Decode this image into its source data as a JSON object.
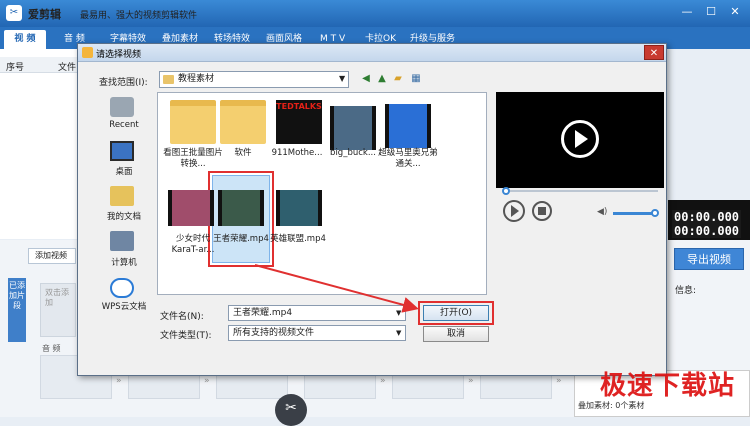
{
  "app": {
    "name": "爱剪辑",
    "slogan": "最易用、强大的视频剪辑软件",
    "tabs": [
      "视 频",
      "音 频",
      "字幕特效",
      "叠加素材",
      "转场特效",
      "画面风格",
      "M T V",
      "卡拉OK",
      "升级与服务"
    ],
    "col_headers": [
      "序号",
      "文件"
    ],
    "add_video": "添加视频",
    "side_tab": "已添加片段",
    "clip_hint": "双击添加",
    "audio_label": "音 频",
    "timecode_1": "00:00.000",
    "timecode_2": "00:00.000",
    "export": "导出视频",
    "info_label": "信息:",
    "info_row_1": "",
    "info_row_2": "叠加素材:    0个素材",
    "watermark": "极速下载站",
    "window_controls": [
      "—",
      "☐",
      "✕"
    ]
  },
  "dialog": {
    "title": "请选择视频",
    "lookin_label": "查找范围(I):",
    "lookin_value": "教程素材",
    "places": [
      "Recent",
      "桌面",
      "我的文档",
      "计算机",
      "WPS云文档"
    ],
    "files": [
      {
        "name": "看图王批量图片转换...",
        "kind": "folder"
      },
      {
        "name": "软件",
        "kind": "folder"
      },
      {
        "name": "911Mothe...",
        "kind": "video",
        "thumb_label": "TEDTALKS"
      },
      {
        "name": "big_buck...",
        "kind": "video"
      },
      {
        "name": "超级马里奥兄弟通关...",
        "kind": "video"
      },
      {
        "name": "少女时代KaraT-ar...",
        "kind": "video"
      },
      {
        "name": "王者荣耀.mp4",
        "kind": "video",
        "selected": true
      },
      {
        "name": "英雄联盟.mp4",
        "kind": "video"
      }
    ],
    "filename_label": "文件名(N):",
    "filename_value": "王者荣耀.mp4",
    "filetype_label": "文件类型(T):",
    "filetype_value": "所有支持的视频文件",
    "open_button": "打开(O)",
    "cancel_button": "取消",
    "close_glyph": "✕"
  },
  "colors": {
    "titlebar": "#2266b3",
    "highlight": "#e03030",
    "export": "#3f86d6"
  }
}
